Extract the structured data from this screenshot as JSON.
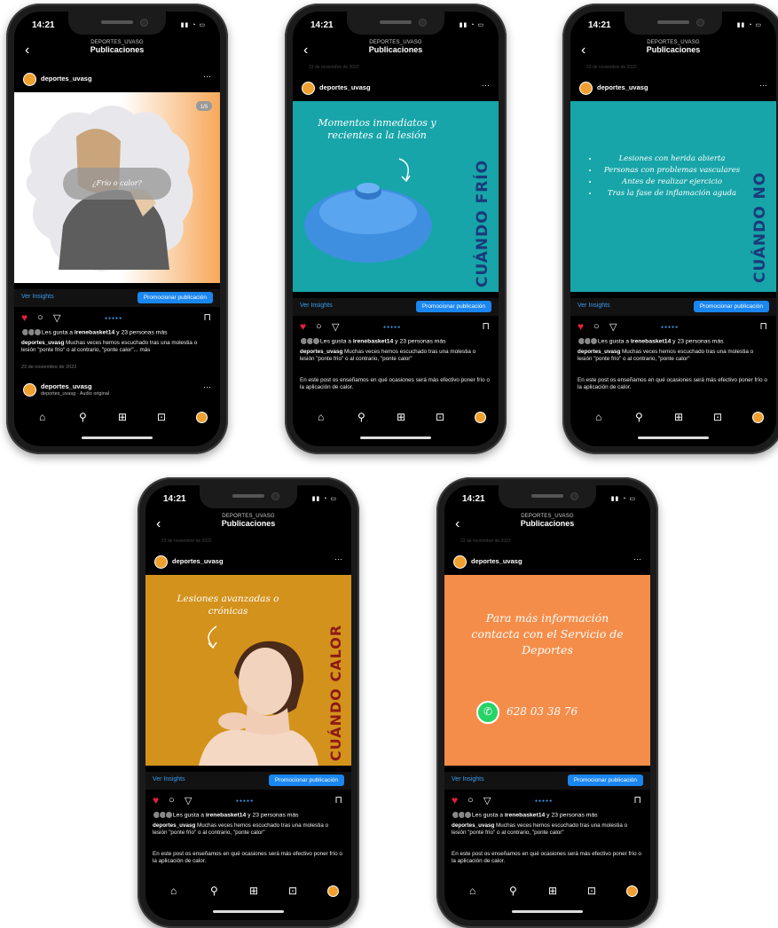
{
  "phones": [
    {
      "time": "14:21",
      "nav_sub": "DEPORTES_UVASG",
      "nav_title": "Publicaciones",
      "username": "deportes_uvasg",
      "badge": "1/5",
      "bubble": "¿Frío o calor?",
      "insights": "Ver Insights",
      "promo": "Promocionar publicación",
      "likes_pre": "Les gusta a ",
      "likes_user": "irenebasket14",
      "likes_post": " y 23 personas más",
      "caption_user": "deportes_uvasg",
      "caption": " Muchas veces hemos escuchado tras una molestia o lesión \"ponte frío\" o al contrario, \"ponte calor\"... más",
      "date": "23 de noviembre de 2022",
      "reel_user": "deportes_uvasg",
      "reel_sub": "deportes_uvasg · Audio original"
    },
    {
      "time": "14:21",
      "nav_sub": "DEPORTES_UVASG",
      "nav_title": "Publicaciones",
      "faint": "23 de noviembre de 2022",
      "username": "deportes_uvasg",
      "script": "Momentos inmediatos y recientes a la lesión",
      "vertical": "CUÁNDO FRÍO",
      "insights": "Ver Insights",
      "promo": "Promocionar publicación",
      "likes_pre": "Les gusta a ",
      "likes_user": "irenebasket14",
      "likes_post": " y 23 personas más",
      "caption_user": "deportes_uvasg",
      "caption": " Muchas veces hemos escuchado tras una molestia o lesión \"ponte frío\" o al contrario, \"ponte calor\"",
      "caption2": "En este post os enseñamos en qué ocasiones será más efectivo poner frío o la aplicación de calor."
    },
    {
      "time": "14:21",
      "nav_sub": "DEPORTES_UVASG",
      "nav_title": "Publicaciones",
      "faint": "23 de noviembre de 2022",
      "username": "deportes_uvasg",
      "bullets": [
        "Lesiones con herida abierta",
        "Personas con problemas vasculares",
        "Antes de realizar ejercicio",
        "Tras la fase de inflamación aguda"
      ],
      "vertical": "CUÁNDO NO",
      "insights": "Ver Insights",
      "promo": "Promocionar publicación",
      "likes_pre": "Les gusta a ",
      "likes_user": "irenebasket14",
      "likes_post": " y 23 personas más",
      "caption_user": "deportes_uvasg",
      "caption": " Muchas veces hemos escuchado tras una molestia o lesión \"ponte frío\" o al contrario, \"ponte calor\"",
      "caption2": "En este post os enseñamos en qué ocasiones será más efectivo poner frío o la aplicación de calor."
    },
    {
      "time": "14:21",
      "nav_sub": "DEPORTES_UVASG",
      "nav_title": "Publicaciones",
      "faint": "23 de noviembre de 2022",
      "username": "deportes_uvasg",
      "script": "Lesiones avanzadas o crónicas",
      "vertical": "CUÁNDO CALOR",
      "insights": "Ver Insights",
      "promo": "Promocionar publicación",
      "likes_pre": "Les gusta a ",
      "likes_user": "irenebasket14",
      "likes_post": " y 23 personas más",
      "caption_user": "deportes_uvasg",
      "caption": " Muchas veces hemos escuchado tras una molestia o lesión \"ponte frío\" o al contrario, \"ponte calor\"",
      "caption2": "En este post os enseñamos en qué ocasiones será más efectivo poner frío o la aplicación de calor."
    },
    {
      "time": "14:21",
      "nav_sub": "DEPORTES_UVASG",
      "nav_title": "Publicaciones",
      "faint": "23 de noviembre de 2022",
      "username": "deportes_uvasg",
      "script": "Para más información contacta con el Servicio de Deportes",
      "phone": "628 03 38 76",
      "insights": "Ver Insights",
      "promo": "Promocionar publicación",
      "likes_pre": "Les gusta a ",
      "likes_user": "irenebasket14",
      "likes_post": " y 23 personas más",
      "caption_user": "deportes_uvasg",
      "caption": " Muchas veces hemos escuchado tras una molestia o lesión \"ponte frío\" o al contrario, \"ponte calor\"",
      "caption2": "En este post os enseñamos en qué ocasiones será más efectivo poner frío o la aplicación de calor."
    }
  ],
  "colors": {
    "teal": "#17a5a9",
    "mustard": "#d3921c",
    "orange": "#f58d4a",
    "navy": "#1a3a7a",
    "darkred": "#8c1a14",
    "like_red": "#e8213c",
    "link_blue": "#3c9cf0",
    "promo_blue": "#1a86f0"
  },
  "icons": [
    "back-chevron-icon",
    "heart-icon",
    "comment-icon",
    "share-icon",
    "bookmark-icon",
    "home-icon",
    "search-icon",
    "add-icon",
    "reels-icon",
    "whatsapp-icon"
  ]
}
